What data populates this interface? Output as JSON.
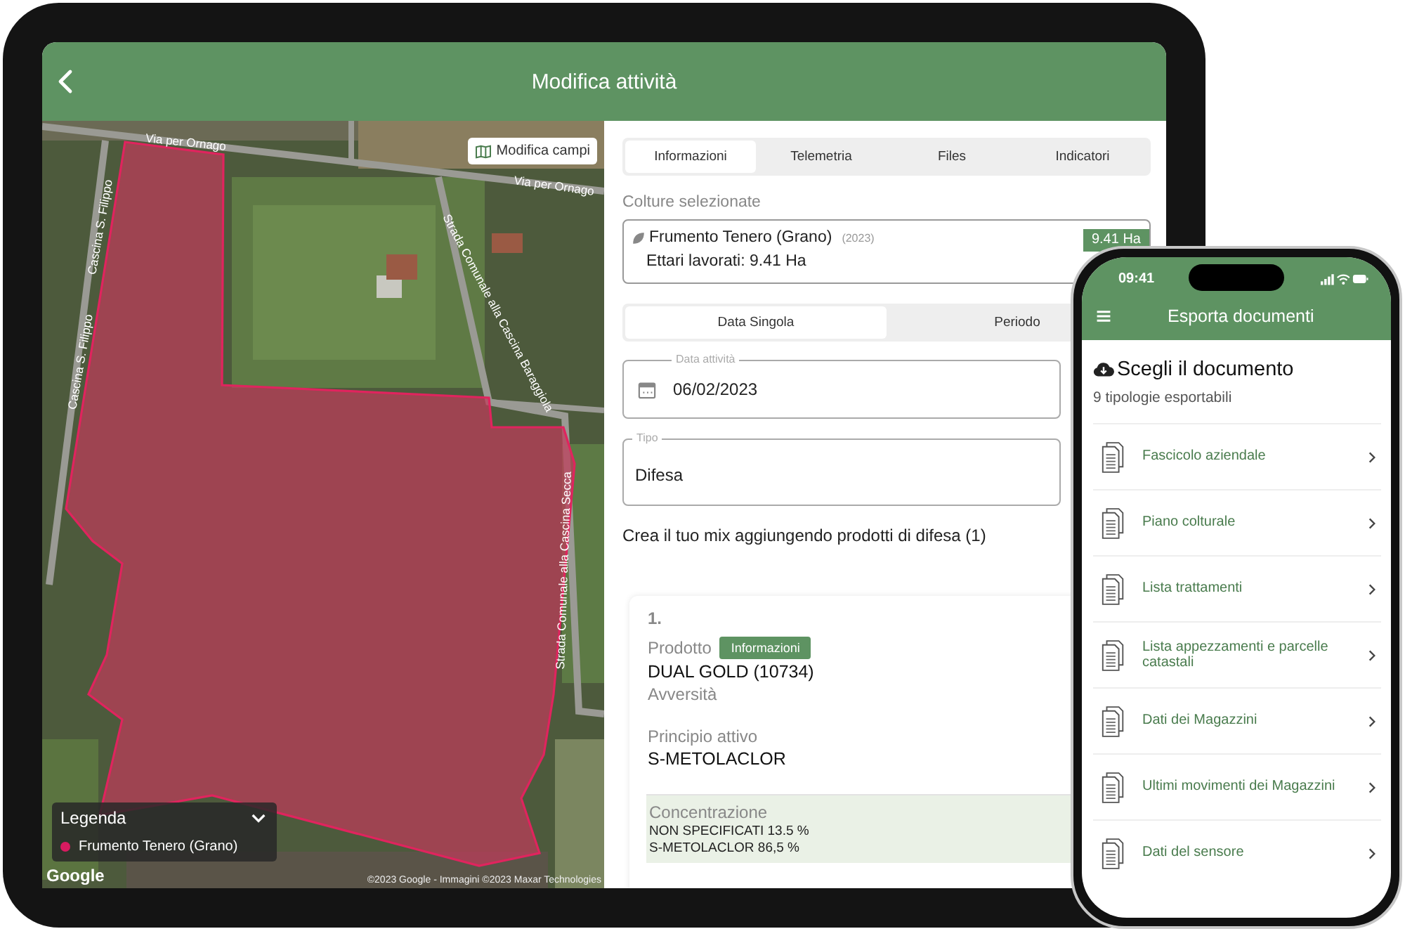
{
  "tablet": {
    "header": {
      "title": "Modifica attività"
    },
    "map": {
      "edit_button": "Modifica campi",
      "road_labels": [
        "Via per Ornago",
        "Via per Ornago",
        "Cascina S. Filippo",
        "Cascina S. Filippo",
        "Strada Comunale alla Cascina Baraggiola",
        "Strada Comunale alla Cascina Secca"
      ],
      "legend": {
        "title": "Legenda",
        "expanded": true,
        "items": [
          {
            "label": "Frumento Tenero (Grano)",
            "color": "#d81b60"
          }
        ]
      },
      "attribution": "Google",
      "copyright": "©2023 Google - Immagini ©2023 Maxar Technologies"
    },
    "tabs": [
      {
        "label": "Informazioni",
        "selected": true
      },
      {
        "label": "Telemetria",
        "selected": false
      },
      {
        "label": "Files",
        "selected": false
      },
      {
        "label": "Indicatori",
        "selected": false
      }
    ],
    "crops": {
      "label": "Colture selezionate",
      "items": [
        {
          "name": "Frumento Tenero (Grano)",
          "year": "(2023)",
          "detail": "Ettari lavorati: 9.41 Ha",
          "badge": "9.41 Ha"
        }
      ]
    },
    "date_mode": [
      {
        "label": "Data Singola",
        "selected": true
      },
      {
        "label": "Periodo",
        "selected": false
      }
    ],
    "date_field": {
      "label": "Data attività",
      "value": "06/02/2023"
    },
    "type_field": {
      "label": "Tipo",
      "value": "Difesa"
    },
    "mix_title": "Crea il tuo mix aggiungendo prodotti di difesa (1)",
    "products": [
      {
        "number": "1.",
        "product_label": "Prodotto",
        "info_button": "Informazioni",
        "product": "DUAL GOLD (10734)",
        "adversity_label": "Avversità",
        "ingredient_label": "Principio attivo",
        "ingredient": "S-METOLACLOR",
        "concentration_label": "Concentrazione",
        "concentrations": [
          "NON SPECIFICATI 13.5 %",
          "S-METOLACLOR 86,5 %"
        ]
      }
    ]
  },
  "phone": {
    "status": {
      "time": "09:41"
    },
    "header": {
      "title": "Esporta documenti"
    },
    "heading": "Scegli il documento",
    "subtitle": "9 tipologie esportabili",
    "documents": [
      "Fascicolo aziendale",
      "Piano colturale",
      "Lista trattamenti",
      "Lista appezzamenti e parcelle catastali",
      "Dati dei Magazzini",
      "Ultimi movimenti dei Magazzini",
      "Dati del sensore"
    ]
  }
}
